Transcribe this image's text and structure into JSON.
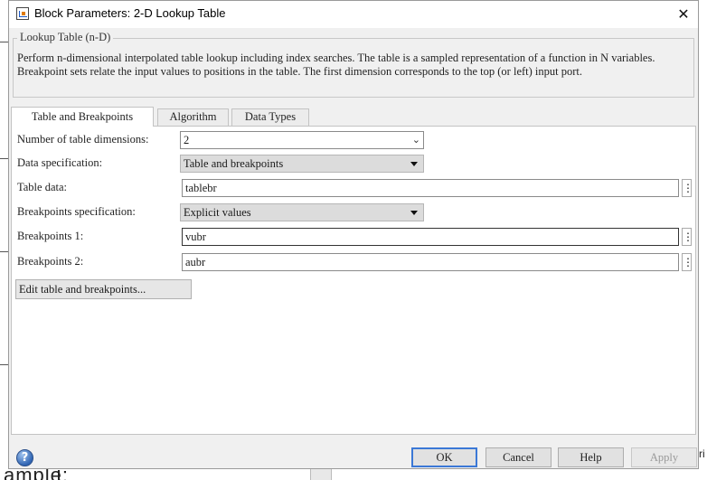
{
  "window": {
    "title": "Block Parameters: 2-D Lookup Table",
    "app_icon": "simulink-block-icon",
    "close_icon": "close-icon"
  },
  "group": {
    "title": "Lookup Table (n-D)",
    "description": "Perform n-dimensional interpolated table lookup including index searches. The table is a sampled representation of a function in N variables. Breakpoint sets relate the input values to positions in the table. The first dimension corresponds to the top (or left) input port."
  },
  "tabs": [
    {
      "label": "Table and Breakpoints",
      "active": true
    },
    {
      "label": "Algorithm",
      "active": false
    },
    {
      "label": "Data Types",
      "active": false
    }
  ],
  "form": {
    "num_dims": {
      "label": "Number of table dimensions:",
      "value": "2"
    },
    "data_spec": {
      "label": "Data specification:",
      "value": "Table and breakpoints"
    },
    "table_data": {
      "label": "Table data:",
      "value": "tablebr"
    },
    "bp_spec": {
      "label": "Breakpoints specification:",
      "value": "Explicit values"
    },
    "bp1": {
      "label": "Breakpoints 1:",
      "value": "vubr"
    },
    "bp2": {
      "label": "Breakpoints 2:",
      "value": "aubr"
    },
    "more_glyph": "⋮"
  },
  "edit_button": "Edit table and breakpoints...",
  "footer": {
    "help_glyph": "?",
    "ok": "OK",
    "cancel": "Cancel",
    "help": "Help",
    "apply": "Apply"
  },
  "background": {
    "bottom_text": "ample:",
    "right_text": "ri"
  }
}
